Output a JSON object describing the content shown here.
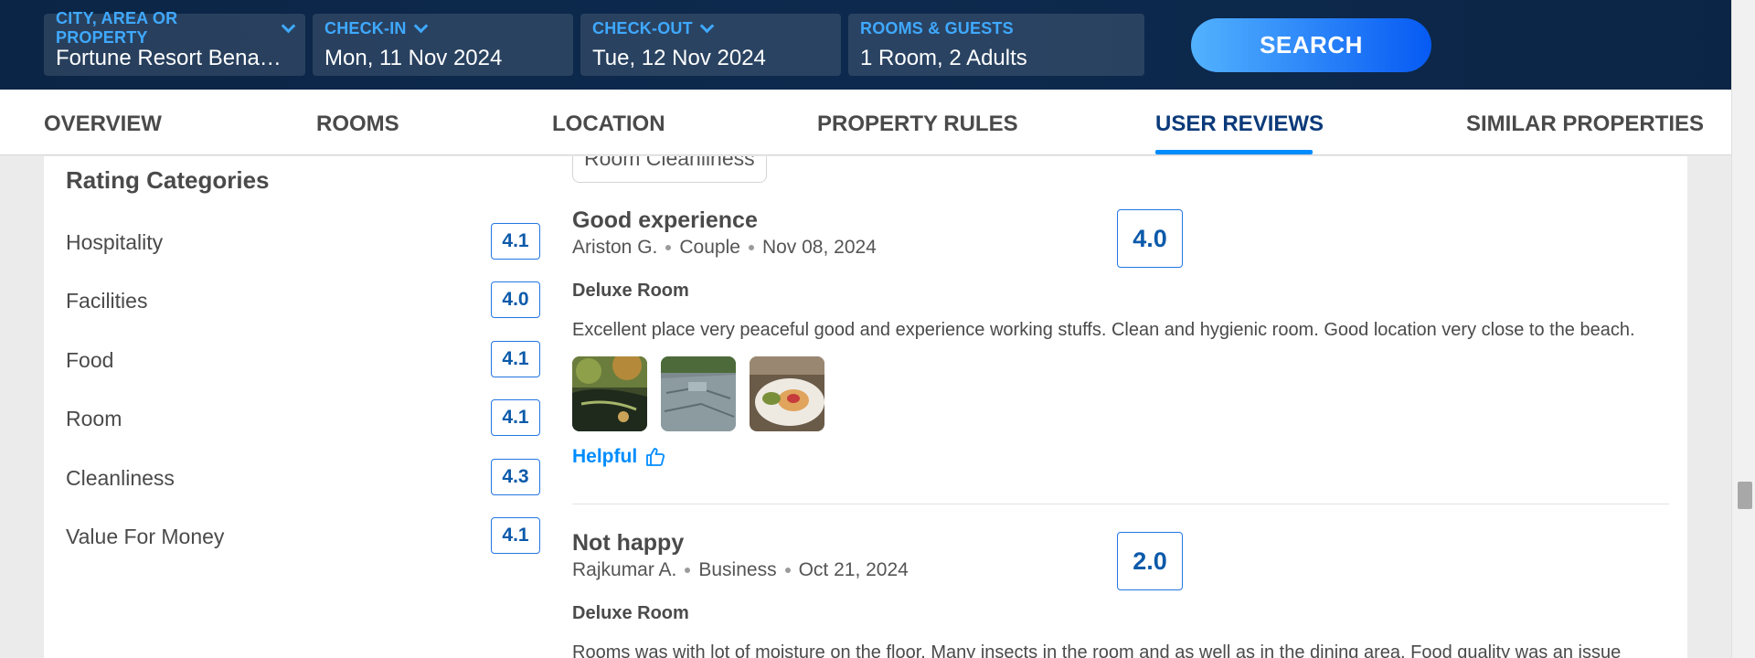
{
  "search": {
    "city_label": "CITY, AREA OR PROPERTY",
    "city_value": "Fortune Resort Benaulim",
    "checkin_label": "CHECK-IN",
    "checkin_value": "Mon, 11 Nov 2024",
    "checkout_label": "CHECK-OUT",
    "checkout_value": "Tue, 12 Nov 2024",
    "guests_label": "ROOMS & GUESTS",
    "guests_value": "1 Room, 2 Adults",
    "button_label": "SEARCH"
  },
  "tabs": [
    {
      "label": "OVERVIEW"
    },
    {
      "label": "ROOMS"
    },
    {
      "label": "LOCATION"
    },
    {
      "label": "PROPERTY RULES"
    },
    {
      "label": "USER REVIEWS",
      "active": true
    },
    {
      "label": "SIMILAR PROPERTIES"
    }
  ],
  "rating_categories": {
    "title": "Rating Categories",
    "items": [
      {
        "name": "Hospitality",
        "score": "4.1"
      },
      {
        "name": "Facilities",
        "score": "4.0"
      },
      {
        "name": "Food",
        "score": "4.1"
      },
      {
        "name": "Room",
        "score": "4.1"
      },
      {
        "name": "Cleanliness",
        "score": "4.3"
      },
      {
        "name": "Value For Money",
        "score": "4.1"
      }
    ]
  },
  "filter_chip": "Room Cleanliness",
  "reviews": [
    {
      "title": "Good experience",
      "author": "Ariston G.",
      "traveller_type": "Couple",
      "date": "Nov 08, 2024",
      "room": "Deluxe Room",
      "text": "Excellent place very peaceful good and experience working stuffs. Clean and hygienic room. Good location very close to the beach.",
      "score": "4.0",
      "photos": [
        "garden-pond-photo",
        "pool-deck-photo",
        "food-plate-photo"
      ],
      "helpful_label": "Helpful"
    },
    {
      "title": "Not happy",
      "author": "Rajkumar A.",
      "traveller_type": "Business",
      "date": "Oct 21, 2024",
      "room": "Deluxe Room",
      "text": "Rooms was with lot of moisture on the floor. Many insects in the room and as well as in the dining area. Food quality was an issue",
      "score": "2.0"
    }
  ],
  "colors": {
    "header_bg": "#0b2546",
    "accent_blue": "#008cff",
    "score_blue": "#0c5aaa"
  }
}
